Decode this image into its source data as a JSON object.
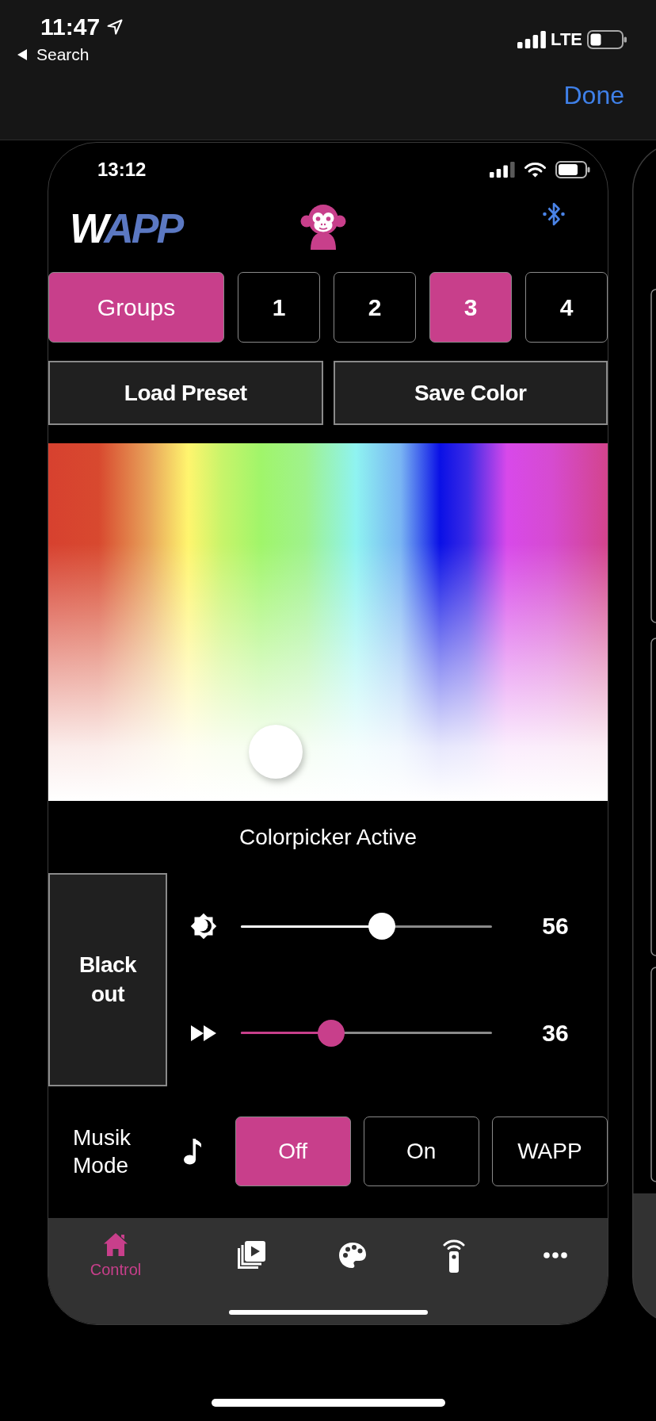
{
  "status_bar": {
    "time": "11:47",
    "back_label": "Search",
    "network": "LTE"
  },
  "nav_bar": {
    "done": "Done"
  },
  "app": {
    "status_bar": {
      "time": "13:12"
    },
    "logo": {
      "lead": "W",
      "rest": "APP"
    },
    "groups": [
      {
        "label": "Groups",
        "kind": "all",
        "selected": true
      },
      {
        "label": "1",
        "kind": "number",
        "selected": false
      },
      {
        "label": "2",
        "kind": "number",
        "selected": false
      },
      {
        "label": "3",
        "kind": "number",
        "selected": true
      },
      {
        "label": "4",
        "kind": "number",
        "selected": false
      }
    ],
    "actions": [
      "Load Preset",
      "Save Color"
    ],
    "colorpicker": {
      "caption": "Colorpicker Active"
    },
    "blackout": "Black out",
    "sliders": [
      {
        "kind": "brightness",
        "level": 0.56,
        "reading": "56"
      },
      {
        "kind": "speed",
        "level": 0.36,
        "reading": "36"
      }
    ],
    "music_mode": {
      "label": "Musik Mode",
      "options": [
        {
          "label": "Off",
          "selected": true
        },
        {
          "label": "On",
          "selected": false
        },
        {
          "label": "WAPP",
          "selected": false
        }
      ]
    },
    "tab_bar": [
      {
        "label": "Control",
        "selected": true
      },
      {
        "selected": false
      },
      {
        "selected": false
      },
      {
        "selected": false
      },
      {
        "selected": false
      }
    ]
  }
}
